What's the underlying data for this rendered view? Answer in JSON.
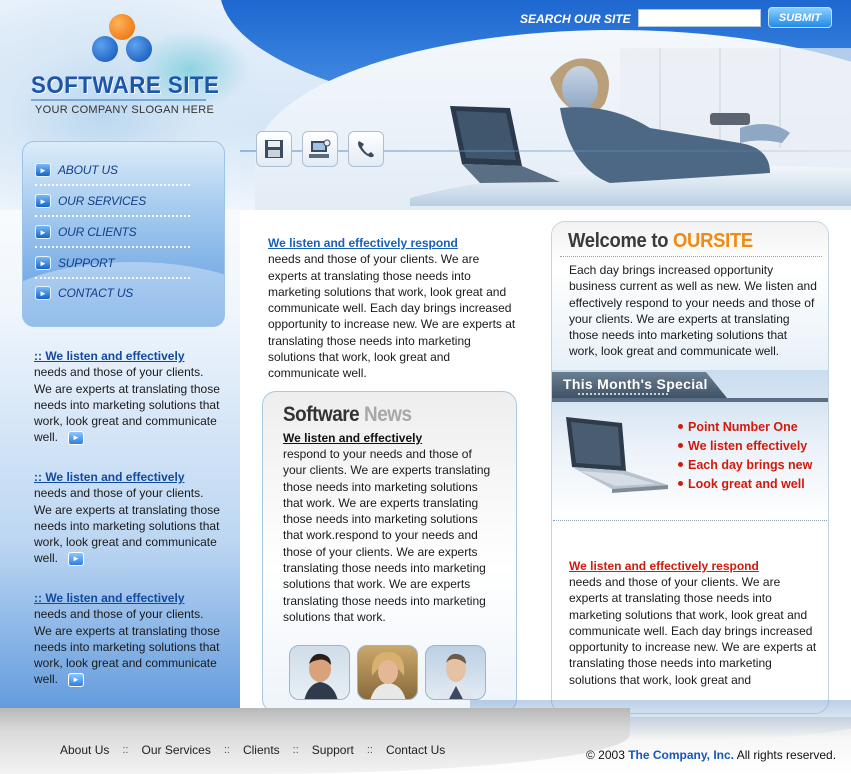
{
  "header": {
    "logo_title": "SOFTWARE SITE",
    "slogan": "YOUR COMPANY SLOGAN HERE",
    "search_label": "SEARCH OUR SITE",
    "search_value": "",
    "submit_label": "SUBMIT",
    "icons": [
      "save-icon",
      "computer-icon",
      "phone-icon"
    ]
  },
  "nav": {
    "items": [
      {
        "label": "ABOUT US"
      },
      {
        "label": "OUR SERVICES"
      },
      {
        "label": "OUR CLIENTS"
      },
      {
        "label": "SUPPORT"
      },
      {
        "label": "CONTACT US"
      }
    ]
  },
  "left_blocks": [
    {
      "heading": ":: We listen and effectively",
      "body": "needs and those of your clients. We are experts at translating those needs into marketing solutions that work, look great and communicate well."
    },
    {
      "heading": ":: We listen and effectively",
      "body": "needs and those of your clients. We are experts at translating those needs into marketing solutions that work, look great and communicate well."
    },
    {
      "heading": ":: We listen and effectively",
      "body": "needs and those of your clients. We are experts at translating those needs into marketing solutions that work, look great and communicate well."
    }
  ],
  "middle": {
    "intro_heading": "We listen and effectively respond",
    "intro_body": "needs and those of your clients. We are experts at translating  those needs into marketing solutions that work, look great and communicate well. Each day brings increased opportunity to increase new.  We are experts at translating  those needs into marketing solutions that work, look great and communicate well.",
    "news_title_1": "Software",
    "news_title_2": "News",
    "news_heading": "We listen and effectively",
    "news_body": "respond to your needs and those of your clients. We are experts translating those needs into marketing solutions that work. We are experts translating those needs into marketing solutions that work.respond to your needs and those of your clients. We are experts translating those needs into marketing solutions that work. We are experts translating those needs into marketing solutions that work."
  },
  "right": {
    "welcome_1": "Welcome to",
    "welcome_2": "OURSITE",
    "welcome_body": "Each day brings increased opportunity business current as well as new.  We listen and effectively respond to your needs and those of your clients. We are experts at translating those needs into marketing solutions that work, look great and communicate well.",
    "special_title": "This Month's Special",
    "special_items": [
      "Point Number One",
      "We listen effectively",
      "Each day brings new",
      "Look great and well"
    ],
    "heading": "We listen and effectively respond",
    "body": "needs and those of your clients. We are experts at translating  those needs into marketing solutions that work, look great and communicate well. Each day brings increased opportunity to increase new.  We are experts at translating  those needs into marketing solutions that work, look great and"
  },
  "footer": {
    "links": [
      "About Us",
      "Our Services",
      "Clients",
      "Support",
      "Contact Us"
    ],
    "separator": "::",
    "copyright_prefix": "© 2003",
    "company": "The Company, Inc.",
    "copyright_suffix": "All rights reserved."
  },
  "colors": {
    "brand_blue": "#1d56a8",
    "accent_orange": "#f08a10",
    "special_red": "#d21a0c"
  }
}
